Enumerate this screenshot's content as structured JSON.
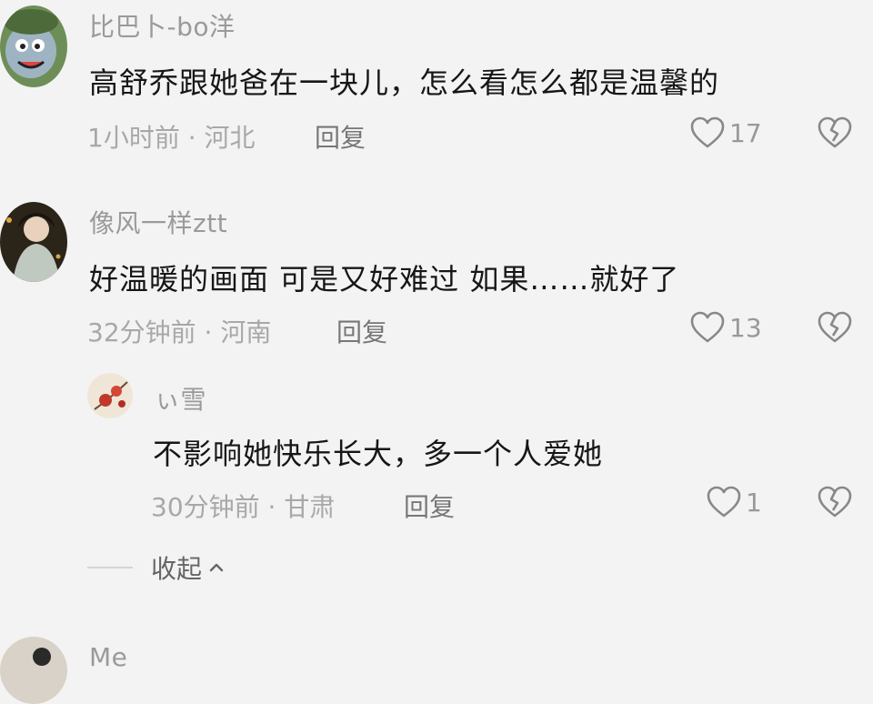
{
  "comments": [
    {
      "username": "比巴卜-bo洋",
      "text": "高舒乔跟她爸在一块儿，怎么看怎么都是温馨的",
      "meta": "1小时前 · 河北",
      "reply_label": "回复",
      "likes": "17"
    },
    {
      "username": "像风一样ztt",
      "text": "好温暖的画面 可是又好难过 如果……就好了",
      "meta": "32分钟前 · 河南",
      "reply_label": "回复",
      "likes": "13"
    }
  ],
  "reply": {
    "username": "ぃ雪",
    "text": "不影响她快乐长大，多一个人爱她",
    "meta": "30分钟前 · 甘肃",
    "reply_label": "回复",
    "likes": "1"
  },
  "collapse_label": "收起",
  "next_comment": {
    "username": "Me"
  },
  "colors": {
    "background": "#f3f3f3",
    "secondary_text": "#9a9a9a",
    "icon": "#888888"
  },
  "icons": [
    "heart-outline-icon",
    "broken-heart-icon",
    "chevron-up-icon"
  ]
}
